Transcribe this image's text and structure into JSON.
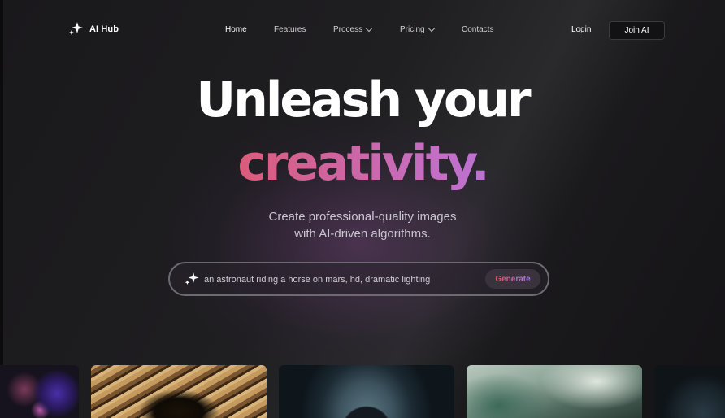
{
  "brand": {
    "name": "AI Hub",
    "icon": "sparkle-icon"
  },
  "nav": {
    "items": [
      {
        "label": "Home",
        "active": true,
        "has_dropdown": false
      },
      {
        "label": "Features",
        "active": false,
        "has_dropdown": false
      },
      {
        "label": "Process",
        "active": false,
        "has_dropdown": true
      },
      {
        "label": "Pricing",
        "active": false,
        "has_dropdown": true
      },
      {
        "label": "Contacts",
        "active": false,
        "has_dropdown": false
      }
    ],
    "login_label": "Login",
    "join_label": "Join AI"
  },
  "hero": {
    "title_line1": "Unleash your",
    "title_line2": "creativity.",
    "subtitle_line1": "Create professional-quality images",
    "subtitle_line2": "with AI-driven algorithms."
  },
  "prompt": {
    "value": "an astronaut riding a horse on mars, hd, dramatic lighting",
    "icon": "sparkle-icon",
    "button_label": "Generate"
  },
  "colors": {
    "gradient_start": "#e4515b",
    "gradient_end": "#a57cf0",
    "background": "#161518"
  },
  "gallery": {
    "tiles": [
      "flowers-image",
      "feather-eye-image",
      "astronaut-portrait-image",
      "green-abstract-image",
      "dark-orb-image"
    ]
  }
}
